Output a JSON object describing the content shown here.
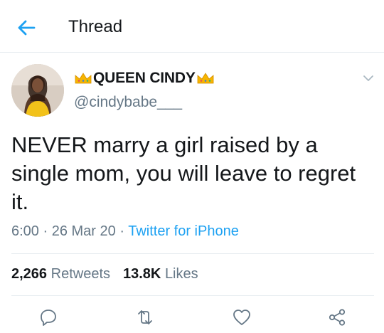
{
  "header": {
    "title": "Thread",
    "back_icon": "arrow-left-icon"
  },
  "colors": {
    "accent": "#1da1f2",
    "text_primary": "#14171a",
    "text_secondary": "#657786",
    "divider": "#e6ecf0",
    "crown": "#f7b500"
  },
  "tweet": {
    "author": {
      "display_name": "QUEEN CINDY",
      "name_emoji": "crown",
      "handle": "@cindybabe___"
    },
    "text": "NEVER marry a girl raised by a single mom, you will leave to regret it.",
    "time": "6:00",
    "date": "26 Mar 20",
    "source": "Twitter for iPhone",
    "retweets_count": "2,266",
    "retweets_label": "Retweets",
    "likes_count": "13.8K",
    "likes_label": "Likes"
  },
  "actions": {
    "icons": [
      "reply-icon",
      "retweet-icon",
      "like-icon",
      "share-icon"
    ]
  }
}
